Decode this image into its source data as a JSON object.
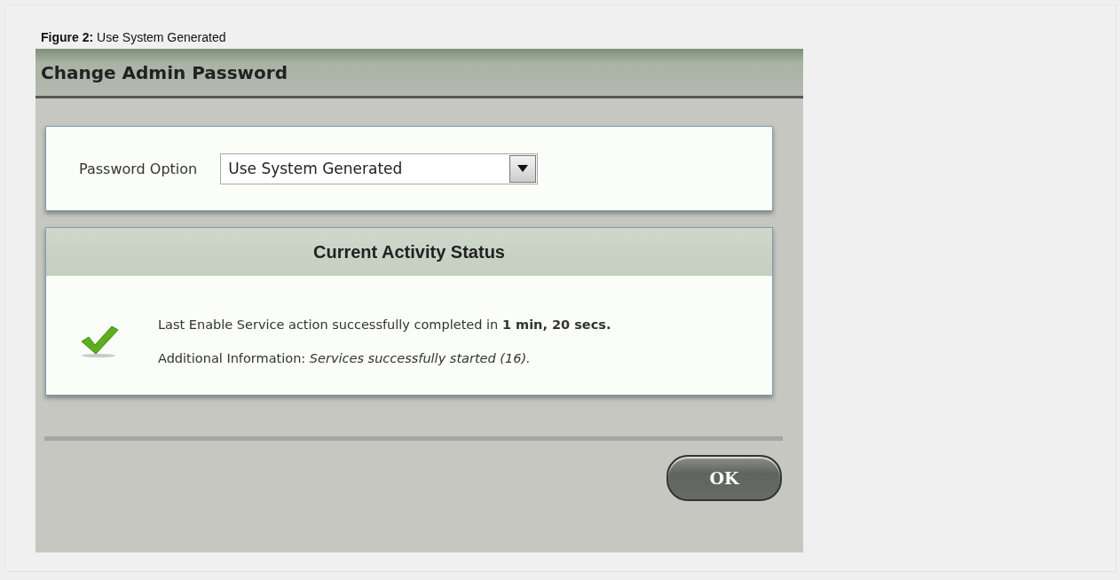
{
  "caption": {
    "label": "Figure 2:",
    "text": "Use System Generated"
  },
  "dialog": {
    "title": "Change Admin Password",
    "option": {
      "label": "Password Option",
      "value": "Use System Generated"
    },
    "status": {
      "heading": "Current Activity Status",
      "message": "Last Enable Service action successfully completed in **1 min, 20 secs.**",
      "info": "Additional Information: *Services successfully started (16).*"
    },
    "buttons": [
      "OK"
    ]
  }
}
